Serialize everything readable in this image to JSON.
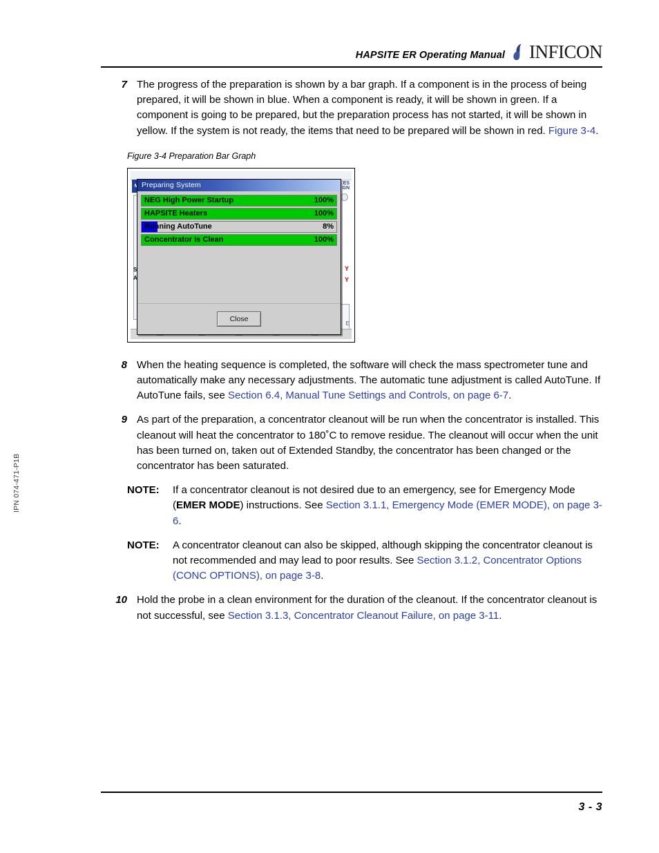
{
  "header": {
    "title": "HAPSITE ER Operating Manual",
    "logo_text": "INFICON",
    "logo_icon": "inficon-droplet-logo"
  },
  "footer": {
    "page_number": "3 - 3"
  },
  "side": {
    "doc_code": "IPN 074-471-P1B"
  },
  "colors": {
    "link": "#2a3fa8",
    "bar_ready_green": "#00c800",
    "bar_running_blue": "#0000e0",
    "bar_track_gray": "#cfcfcf",
    "title_bar_start": "#1d3a96",
    "title_bar_end": "#b4cbf2"
  },
  "steps": {
    "step7": {
      "number": "7",
      "text_1": "The progress of the preparation is shown by a bar graph. If a component is in the process of being prepared, it will be shown in blue. When a component is ready, it will be shown in green. If a component is going to be prepared, but the preparation process has not started, it will be shown in yellow. If the system is not ready, the items that need to be prepared will be shown in red. ",
      "link_1": "Figure 3-4",
      "text_2": "."
    },
    "step8": {
      "number": "8",
      "text_1": "When the heating sequence is completed, the software will check the mass spectrometer tune and automatically make any necessary adjustments. The automatic tune adjustment is called AutoTune. If AutoTune fails, see ",
      "link_1": "Section 6.4, Manual Tune Settings and Controls, on page 6-7",
      "text_2": "."
    },
    "step9": {
      "number": "9",
      "text_1": "As part of the preparation, a concentrator cleanout will be run when the concentrator is installed. This cleanout will heat the concentrator to 180˚C to remove residue. The cleanout will occur when the unit has been turned on, taken out of Extended Standby, the concentrator has been changed or the concentrator has been saturated."
    },
    "step10": {
      "number": "10",
      "text_1": "Hold the probe in a clean environment for the duration of the cleanout. If the concentrator cleanout is not successful, see ",
      "link_1": "Section 3.1.3, Concentrator Cleanout Failure, on page 3-11",
      "text_2": "."
    }
  },
  "notes": {
    "note1": {
      "label": "NOTE:",
      "text_1": "If a concentrator cleanout is not desired due to an emergency, see for Emergency Mode (",
      "bold_1": "EMER MODE",
      "text_2": ") instructions. See ",
      "link_1": "Section 3.1.1, Emergency Mode (EMER MODE), on page 3-6",
      "text_3": "."
    },
    "note2": {
      "label": "NOTE:",
      "text_1": "A concentrator cleanout can also be skipped, although skipping the concentrator cleanout is not recommended and may lead to poor results. See ",
      "link_1": "Section 3.1.2, Concentrator Options (CONC OPTIONS), on page 3-8",
      "text_2": "."
    }
  },
  "figure": {
    "caption": "Figure 3-4  Preparation Bar Graph",
    "dialog": {
      "title": "Preparing System",
      "close_label": "Close",
      "bars": [
        {
          "label": "NEG High Power Startup",
          "percent_label": "100%",
          "percent": 100,
          "color": "#00c800"
        },
        {
          "label": "HAPSITE Heaters",
          "percent_label": "100%",
          "percent": 100,
          "color": "#00c800"
        },
        {
          "label": "Running AutoTune",
          "percent_label": "8%",
          "percent": 8,
          "color": "#0000e0"
        },
        {
          "label": "Concentrator is Clean",
          "percent_label": "100%",
          "percent": 100,
          "color": "#00c800"
        }
      ]
    },
    "background": {
      "left_badge": "M",
      "left_text_1": "S",
      "left_text_2": "A",
      "right_chip_1": "ES",
      "right_chip_2": "GN",
      "right_flag_1": "Y",
      "right_flag_2": "Y",
      "right_letter": "E"
    }
  }
}
